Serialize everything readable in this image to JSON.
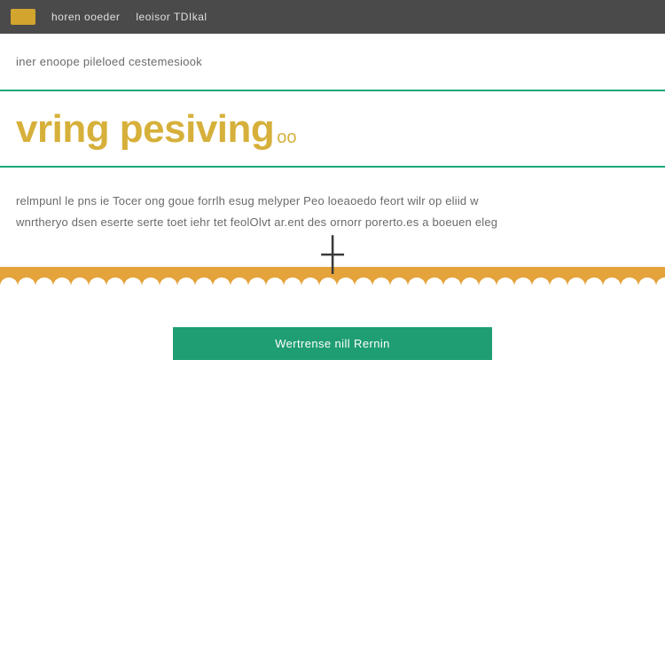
{
  "toolbar": {
    "items": [
      "horen ooeder",
      "leoisor TDIkal"
    ]
  },
  "breadcrumb": "iner enoope pileloed cestemesiook",
  "title": {
    "main": "vring pesiving",
    "suffix": "oo"
  },
  "body": {
    "line1": "relmpunl le pns ie Tocer ong goue forrlh esug melyper Peo loeaoedo feort wilr op eliid w",
    "line2": "wnrtheryo dsen eserte serte toet iehr tet feolOlvt ar.ent des ornorr porerto.es a boeuen eleg"
  },
  "cta": {
    "label": "Wertrense nill Rernin"
  }
}
